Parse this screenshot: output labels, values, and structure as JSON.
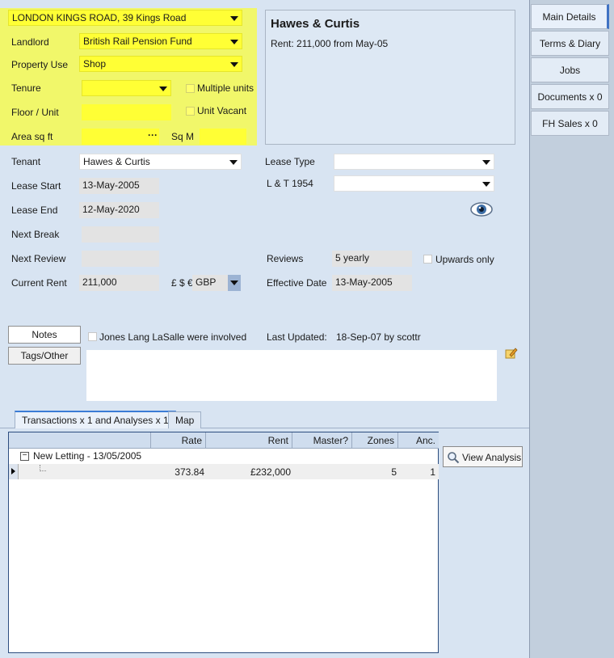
{
  "property": {
    "address": "LONDON KINGS ROAD, 39 Kings Road",
    "landlord_label": "Landlord",
    "landlord": "British Rail Pension Fund",
    "use_label": "Property Use",
    "use": "Shop",
    "tenure_label": "Tenure",
    "tenure": "",
    "multiple_units_label": "Multiple units",
    "floor_label": "Floor / Unit",
    "floor": "",
    "unit_vacant_label": "Unit Vacant",
    "area_label": "Area sq ft",
    "area": "",
    "area_button": "···",
    "sqm_label": "Sq M",
    "sqm": ""
  },
  "summary": {
    "title": "Hawes & Curtis",
    "rent_line": "Rent: 211,000 from May-05"
  },
  "lease": {
    "tenant_label": "Tenant",
    "tenant": "Hawes & Curtis",
    "lease_type_label": "Lease Type",
    "lease_type": "",
    "lease_start_label": "Lease Start",
    "lease_start": "13-May-2005",
    "lt1954_label": "L & T 1954",
    "lt1954": "",
    "lease_end_label": "Lease End",
    "lease_end": "12-May-2020",
    "next_break_label": "Next Break",
    "next_break": "",
    "next_review_label": "Next Review",
    "next_review": "",
    "reviews_label": "Reviews",
    "reviews": "5 yearly",
    "upwards_only_label": "Upwards only",
    "current_rent_label": "Current Rent",
    "current_rent": "211,000",
    "currency_symbols": "£ $ €",
    "currency": "GBP",
    "effective_date_label": "Effective Date",
    "effective_date": "13-May-2005"
  },
  "notes": {
    "notes_button": "Notes",
    "tags_button": "Tags/Other",
    "jll_label": "Jones Lang LaSalle were involved",
    "last_updated_label": "Last Updated:",
    "last_updated": "18-Sep-07 by scottr",
    "text": ""
  },
  "right_tabs": [
    "Main Details",
    "Terms & Diary",
    "Jobs",
    "Documents x 0",
    "FH Sales x 0"
  ],
  "bottom_tabs": [
    "Transactions x 1 and Analyses x 1",
    "Map"
  ],
  "grid": {
    "columns": [
      "",
      "Rate",
      "Rent",
      "Master?",
      "Zones",
      "Anc."
    ],
    "group_label": "New Letting - 13/05/2005",
    "row": {
      "rate": "373.84",
      "rent": "£232,000",
      "master": "",
      "zones": "5",
      "anc": "1"
    }
  },
  "view_analysis_button": "View Analysis",
  "colors": {
    "highlight": "#ffff35",
    "accent": "#3f72c4"
  }
}
